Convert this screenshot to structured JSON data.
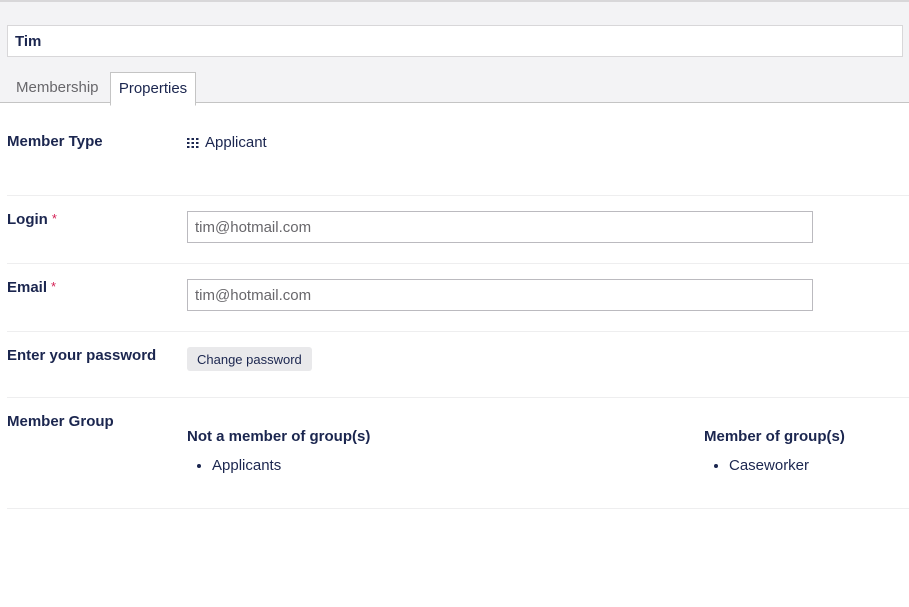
{
  "header": {
    "name_value": "Tim",
    "tabs": [
      {
        "label": "Membership",
        "active": false
      },
      {
        "label": "Properties",
        "active": true
      }
    ]
  },
  "properties": {
    "member_type": {
      "label": "Member Type",
      "icon": "grid-icon",
      "value": "Applicant"
    },
    "login": {
      "label": "Login",
      "required_mark": "*",
      "value": "tim@hotmail.com"
    },
    "email": {
      "label": "Email",
      "required_mark": "*",
      "value": "tim@hotmail.com"
    },
    "password": {
      "label": "Enter your password",
      "button_label": "Change password"
    },
    "member_group": {
      "label": "Member Group",
      "not_member_title": "Not a member of group(s)",
      "not_member_items": [
        "Applicants"
      ],
      "member_title": "Member of group(s)",
      "member_items": [
        "Caseworker"
      ]
    }
  },
  "colors": {
    "text": "#1b264f",
    "required": "#d42054",
    "muted": "#68676b",
    "header_bg": "#f3f3f5"
  }
}
